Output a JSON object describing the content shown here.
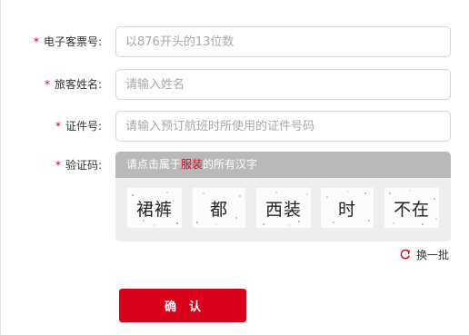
{
  "form": {
    "ticket_no": {
      "required_mark": "*",
      "label": "电子客票号:",
      "placeholder": "以876开头的13位数",
      "value": ""
    },
    "passenger_name": {
      "required_mark": "*",
      "label": "旅客姓名:",
      "placeholder": "请输入姓名",
      "value": ""
    },
    "id_number": {
      "required_mark": "*",
      "label": "证件号:",
      "placeholder": "请输入预订航班时所使用的证件号码",
      "value": ""
    },
    "captcha": {
      "required_mark": "*",
      "label": "验证码:",
      "instruction_prefix": "请点击属于",
      "instruction_keyword": "服装",
      "instruction_suffix": "的所有汉字",
      "tiles": [
        "裙裤",
        "都",
        "西装",
        "时",
        "不在"
      ]
    },
    "refresh_label": "换一批",
    "confirm_label": "确认"
  },
  "colors": {
    "accent": "#d9001b",
    "captcha_header_bg": "#b9b9b9",
    "captcha_body_bg": "#eeeeee"
  }
}
